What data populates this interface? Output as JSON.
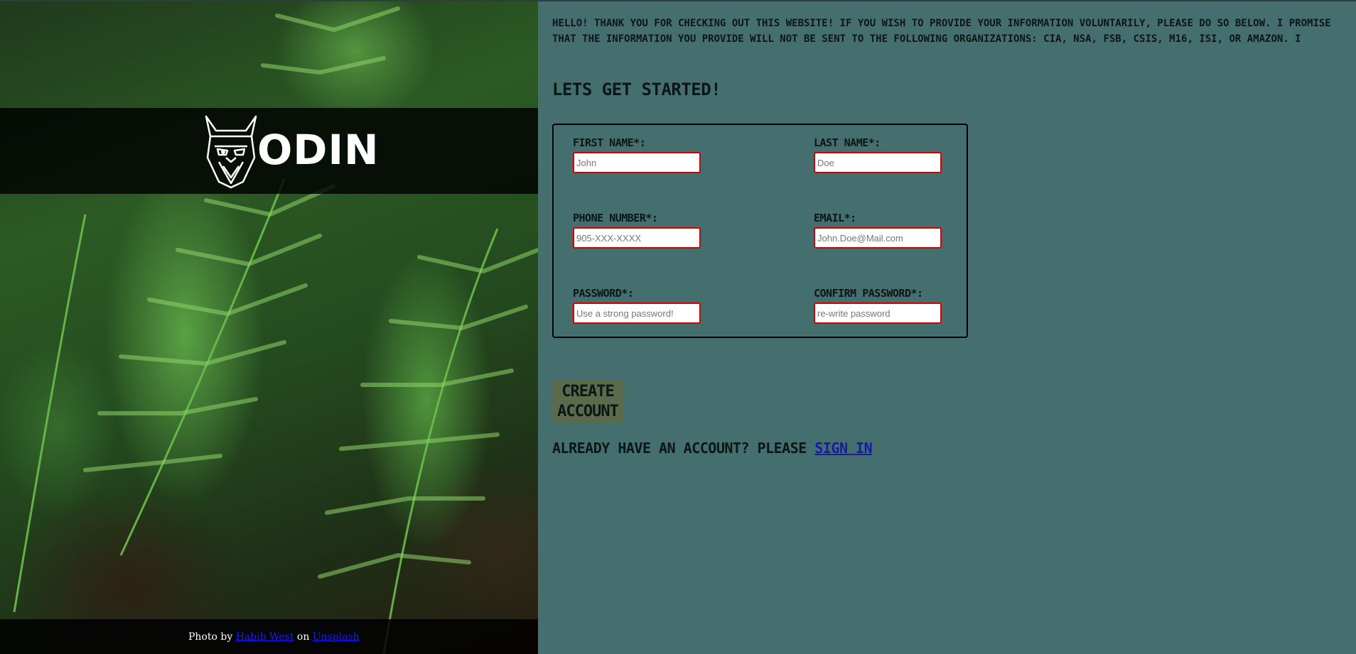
{
  "colors": {
    "page_background": "#456f6f",
    "input_border": "#d60000",
    "button_background": "#5a6a4a",
    "link": "#1a1aa8"
  },
  "brand": {
    "logo_icon": "viking-helmet-face-icon",
    "name": "ODIN"
  },
  "photo_credit": {
    "prefix": "Photo by",
    "author": "Habib West",
    "middle": "on",
    "source": "Unsplash"
  },
  "intro": "HELLO! THANK YOU FOR CHECKING OUT THIS WEBSITE! IF YOU WISH TO PROVIDE YOUR INFORMATION VOLUNTARILY, PLEASE DO SO BELOW. I PROMISE THAT THE INFORMATION YOU PROVIDE WILL NOT BE SENT TO THE FOLLOWING ORGANIZATIONS: CIA, NSA, FSB, CSIS, M16, ISI, OR AMAZON. I PROMISE!",
  "heading": "LETS GET STARTED!",
  "form": {
    "first_name": {
      "label": "FIRST NAME*:",
      "placeholder": "John"
    },
    "last_name": {
      "label": "LAST NAME*:",
      "placeholder": "Doe"
    },
    "phone": {
      "label": "PHONE NUMBER*:",
      "placeholder": "905-XXX-XXXX"
    },
    "email": {
      "label": "EMAIL*:",
      "placeholder": "John.Doe@Mail.com"
    },
    "password": {
      "label": "PASSWORD*:",
      "placeholder": "Use a strong password!"
    },
    "confirm_password": {
      "label": "CONFIRM PASSWORD*:",
      "placeholder": "re-write password"
    }
  },
  "create_button": {
    "line1": "CREATE",
    "line2": "ACCOUNT"
  },
  "signin": {
    "text": "ALREADY HAVE AN ACCOUNT? PLEASE",
    "link": "SIGN IN"
  }
}
